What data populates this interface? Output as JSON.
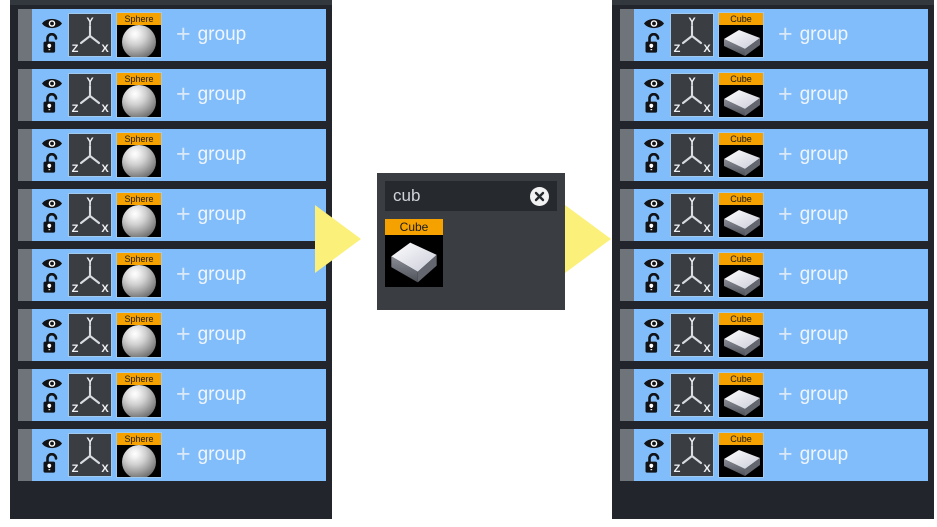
{
  "panels": {
    "left": {
      "name": "object-list-before",
      "rows": [
        {
          "thumb_label": "Sphere",
          "shape": "sphere",
          "group_label": "group",
          "plus": "+",
          "axis": {
            "y": "Y",
            "z": "Z",
            "x": "X"
          }
        },
        {
          "thumb_label": "Sphere",
          "shape": "sphere",
          "group_label": "group",
          "plus": "+",
          "axis": {
            "y": "Y",
            "z": "Z",
            "x": "X"
          }
        },
        {
          "thumb_label": "Sphere",
          "shape": "sphere",
          "group_label": "group",
          "plus": "+",
          "axis": {
            "y": "Y",
            "z": "Z",
            "x": "X"
          }
        },
        {
          "thumb_label": "Sphere",
          "shape": "sphere",
          "group_label": "group",
          "plus": "+",
          "axis": {
            "y": "Y",
            "z": "Z",
            "x": "X"
          }
        },
        {
          "thumb_label": "Sphere",
          "shape": "sphere",
          "group_label": "group",
          "plus": "+",
          "axis": {
            "y": "Y",
            "z": "Z",
            "x": "X"
          }
        },
        {
          "thumb_label": "Sphere",
          "shape": "sphere",
          "group_label": "group",
          "plus": "+",
          "axis": {
            "y": "Y",
            "z": "Z",
            "x": "X"
          }
        },
        {
          "thumb_label": "Sphere",
          "shape": "sphere",
          "group_label": "group",
          "plus": "+",
          "axis": {
            "y": "Y",
            "z": "Z",
            "x": "X"
          }
        },
        {
          "thumb_label": "Sphere",
          "shape": "sphere",
          "group_label": "group",
          "plus": "+",
          "axis": {
            "y": "Y",
            "z": "Z",
            "x": "X"
          }
        }
      ]
    },
    "right": {
      "name": "object-list-after",
      "rows": [
        {
          "thumb_label": "Cube",
          "shape": "cube",
          "group_label": "group",
          "plus": "+",
          "axis": {
            "y": "Y",
            "z": "Z",
            "x": "X"
          }
        },
        {
          "thumb_label": "Cube",
          "shape": "cube",
          "group_label": "group",
          "plus": "+",
          "axis": {
            "y": "Y",
            "z": "Z",
            "x": "X"
          }
        },
        {
          "thumb_label": "Cube",
          "shape": "cube",
          "group_label": "group",
          "plus": "+",
          "axis": {
            "y": "Y",
            "z": "Z",
            "x": "X"
          }
        },
        {
          "thumb_label": "Cube",
          "shape": "cube",
          "group_label": "group",
          "plus": "+",
          "axis": {
            "y": "Y",
            "z": "Z",
            "x": "X"
          }
        },
        {
          "thumb_label": "Cube",
          "shape": "cube",
          "group_label": "group",
          "plus": "+",
          "axis": {
            "y": "Y",
            "z": "Z",
            "x": "X"
          }
        },
        {
          "thumb_label": "Cube",
          "shape": "cube",
          "group_label": "group",
          "plus": "+",
          "axis": {
            "y": "Y",
            "z": "Z",
            "x": "X"
          }
        },
        {
          "thumb_label": "Cube",
          "shape": "cube",
          "group_label": "group",
          "plus": "+",
          "axis": {
            "y": "Y",
            "z": "Z",
            "x": "X"
          }
        },
        {
          "thumb_label": "Cube",
          "shape": "cube",
          "group_label": "group",
          "plus": "+",
          "axis": {
            "y": "Y",
            "z": "Z",
            "x": "X"
          }
        }
      ]
    }
  },
  "search_dialog": {
    "query_value": "cub",
    "query_placeholder": "cub",
    "close_icon": "close-circle-icon",
    "results": [
      {
        "label": "Cube",
        "shape": "cube"
      }
    ]
  },
  "icons": {
    "visibility": "eye-icon",
    "lock": "unlocked-padlock-icon",
    "drag_handle": "drag-handle",
    "arrow": "arrow-right-icon"
  },
  "colors": {
    "row_selected": "#82bdfb",
    "panel_background": "#22252b",
    "label_orange": "#f5a200",
    "arrow_yellow": "#faf07a",
    "handle_gray": "#6f737a",
    "dialog_background": "#3a3d42",
    "field_background": "#26292e"
  }
}
